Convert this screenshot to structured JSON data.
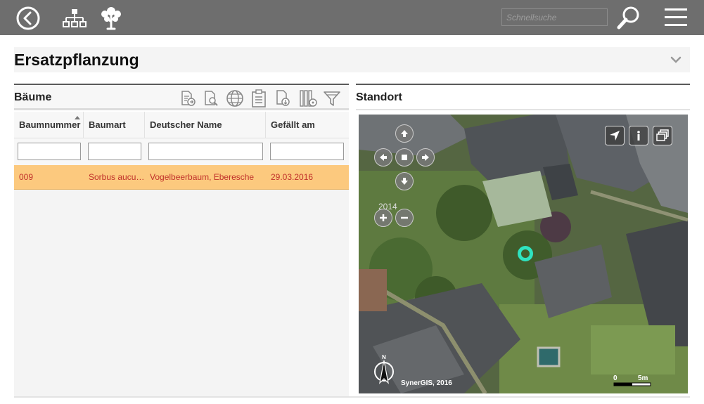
{
  "topbar": {
    "back_icon": "back-circle-icon",
    "hierarchy_icon": "hierarchy-icon",
    "tree_icon": "tree-icon",
    "search_placeholder": "Schnellsuche",
    "search_icon": "search-icon",
    "menu_icon": "hamburger-menu-icon",
    "bg_color": "#6e6e6e"
  },
  "page": {
    "title": "Ersatzpflanzung",
    "collapse_icon": "chevron-down-icon"
  },
  "trees_panel": {
    "title": "Bäume",
    "tools": [
      "export-icon",
      "document-search-icon",
      "globe-icon",
      "clipboard-icon",
      "download-document-icon",
      "column-settings-icon",
      "filter-icon"
    ],
    "columns": [
      "Baumnummer",
      "Baumart",
      "Deutscher Name",
      "Gefällt am"
    ],
    "sorted_column": "Baumnummer",
    "rows": [
      {
        "baumnummer": "009",
        "baumart": "Sorbus aucuparia",
        "deutscher_name": "Vogelbeerbaum, Eberesche",
        "gefaellt_am": "29.03.2016"
      }
    ],
    "row_highlight_color": "#fcc97e",
    "row_text_color": "#c0302a"
  },
  "location_panel": {
    "title": "Standort",
    "map": {
      "tools": [
        "locate-arrow-icon",
        "info-icon",
        "layers-icon"
      ],
      "zoom_level": "2014",
      "copyright": "SynerGIS, 2016",
      "scale_start": "0",
      "scale_end": "5m",
      "marker_color": "#2fe3c0"
    }
  }
}
